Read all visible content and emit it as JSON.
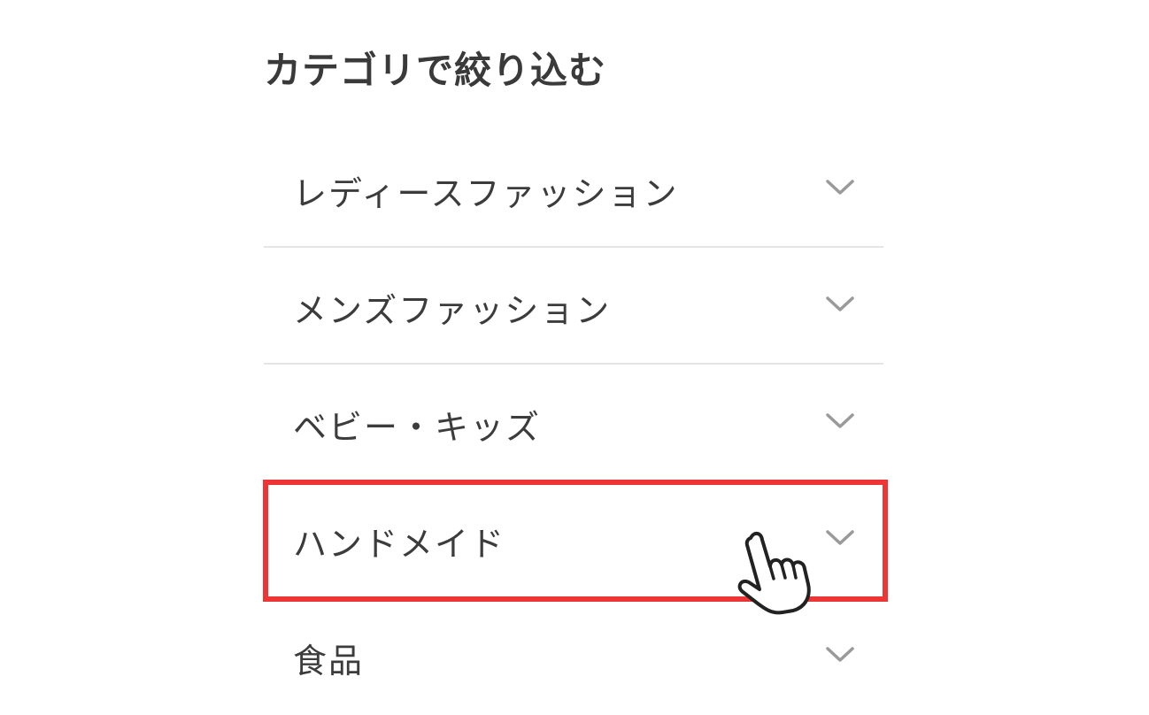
{
  "filter": {
    "title": "カテゴリで絞り込む",
    "categories": [
      {
        "label": "レディースファッション"
      },
      {
        "label": "メンズファッション"
      },
      {
        "label": "ベビー・キッズ"
      },
      {
        "label": "ハンドメイド",
        "highlighted": true
      },
      {
        "label": "食品"
      }
    ]
  },
  "colors": {
    "highlight_border": "#ee3535",
    "divider": "#e4e4e4",
    "chevron": "#9a9a9a"
  },
  "icons": {
    "expand": "chevron-down-icon",
    "pointer": "pointing-hand-cursor-icon"
  }
}
